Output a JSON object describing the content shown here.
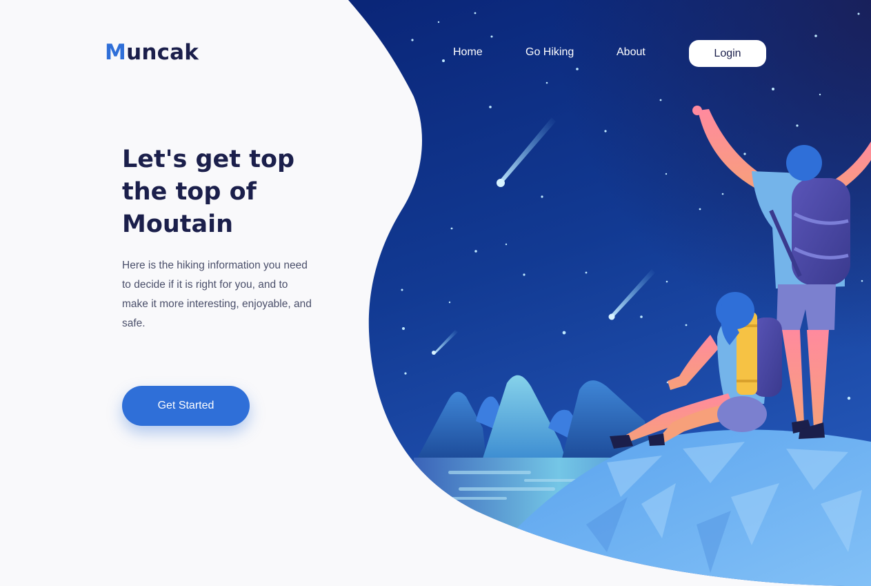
{
  "brand": {
    "initial": "M",
    "rest": "uncak"
  },
  "nav": {
    "items": [
      {
        "label": "Home"
      },
      {
        "label": "Go Hiking"
      },
      {
        "label": "About"
      }
    ],
    "login_label": "Login"
  },
  "hero": {
    "headline": "Let's get top the top of Moutain",
    "description": "Here is the hiking information you need to decide if it is right for you, and to make it more interesting, enjoyable, and safe.",
    "cta_label": "Get Started",
    "illustration": "two-hikers-on-mountain-under-night-sky"
  },
  "colors": {
    "accent": "#2f6fd8",
    "heading": "#1b1f4b",
    "background": "#f9f9fb",
    "night_sky": "#0b2a7a"
  }
}
